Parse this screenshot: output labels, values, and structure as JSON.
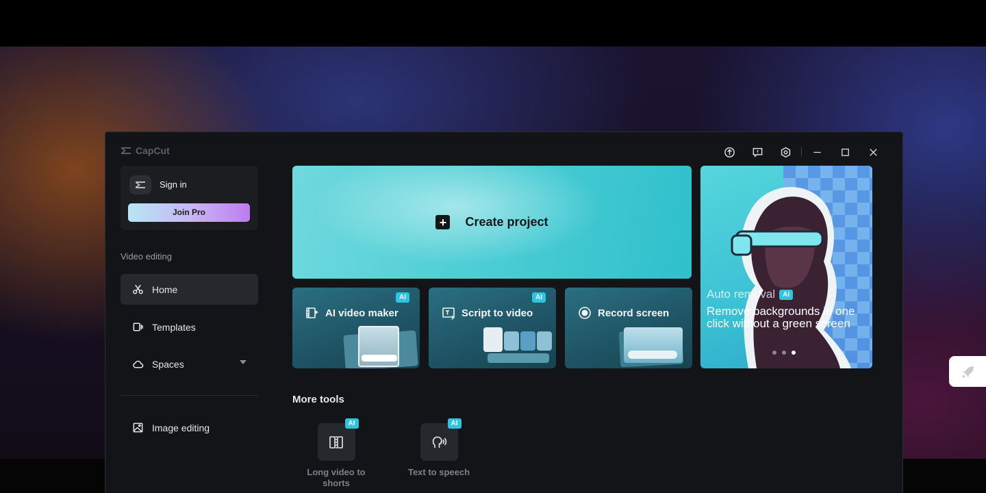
{
  "app": {
    "name": "CapCut"
  },
  "window_controls": {
    "upload": "upload-icon",
    "feedback": "feedback-icon",
    "settings": "settings-icon",
    "minimize": "minimize-icon",
    "maximize": "maximize-icon",
    "close": "close-icon"
  },
  "account": {
    "signin_label": "Sign in",
    "join_pro_label": "Join Pro"
  },
  "sidebar": {
    "section_label": "Video editing",
    "items": [
      {
        "label": "Home",
        "icon": "scissors-icon",
        "active": true
      },
      {
        "label": "Templates",
        "icon": "template-icon",
        "active": false
      },
      {
        "label": "Spaces",
        "icon": "cloud-icon",
        "active": false
      }
    ],
    "image_editing_label": "Image editing"
  },
  "main": {
    "create_project_label": "Create project",
    "tools": [
      {
        "label": "AI video maker",
        "badge": "AI"
      },
      {
        "label": "Script to video",
        "badge": "AI"
      },
      {
        "label": "Record screen"
      }
    ],
    "banner": {
      "subtitle": "Auto removal",
      "badge": "AI",
      "description": "Remove backgrounds in one click without a green screen",
      "active_slide": 3,
      "slide_count": 3
    },
    "more_tools_title": "More tools",
    "more_tools": [
      {
        "label": "Long video to shorts",
        "badge": "AI"
      },
      {
        "label": "Text to speech",
        "badge": "AI"
      }
    ]
  },
  "colors": {
    "accent": "#2fc4df",
    "window_bg": "#121417",
    "create_card": "#4ccdd4"
  }
}
